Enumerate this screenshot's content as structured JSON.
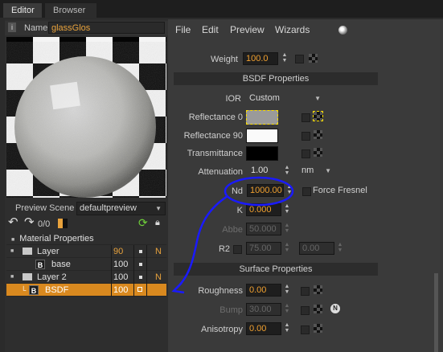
{
  "tabs": [
    {
      "label": "Editor"
    },
    {
      "label": "Browser"
    }
  ],
  "name_field": {
    "label": "Name",
    "value": "glassGlos"
  },
  "preview_scene": {
    "label": "Preview Scene",
    "value": "defaultpreview"
  },
  "toolbar": {
    "counter": "0/0"
  },
  "tree": {
    "header": "Material Properties",
    "rows": [
      {
        "label": "Layer",
        "value": "90",
        "flag": "N"
      },
      {
        "label": "base",
        "value": "100",
        "flag": ""
      },
      {
        "label": "Layer 2",
        "value": "100",
        "flag": "N"
      },
      {
        "label": "BSDF",
        "value": "100",
        "flag": ""
      }
    ]
  },
  "menu": {
    "items": [
      "File",
      "Edit",
      "Preview",
      "Wizards"
    ]
  },
  "properties": {
    "weight": {
      "label": "Weight",
      "value": "100.0"
    },
    "bsdf_section": "BSDF Properties",
    "ior": {
      "label": "IOR",
      "value": "Custom"
    },
    "reflectance0": {
      "label": "Reflectance 0"
    },
    "reflectance90": {
      "label": "Reflectance 90"
    },
    "transmittance": {
      "label": "Transmittance"
    },
    "attenuation": {
      "label": "Attenuation",
      "value": "1.00",
      "unit": "nm"
    },
    "nd": {
      "label": "Nd",
      "value": "1000.00",
      "force_fresnel": "Force Fresnel"
    },
    "k": {
      "label": "K",
      "value": "0.000"
    },
    "abbe": {
      "label": "Abbe",
      "value": "50.000"
    },
    "r2": {
      "label": "R2",
      "value1": "75.00",
      "value2": "0.00"
    },
    "surface_section": "Surface Properties",
    "roughness": {
      "label": "Roughness",
      "value": "0.00"
    },
    "bump": {
      "label": "Bump",
      "value": "30.00"
    },
    "anisotropy": {
      "label": "Anisotropy",
      "value": "0.00"
    }
  },
  "colors": {
    "accent": "#d9891f",
    "value_text": "#f0a030",
    "annotation": "#1a1aff"
  }
}
